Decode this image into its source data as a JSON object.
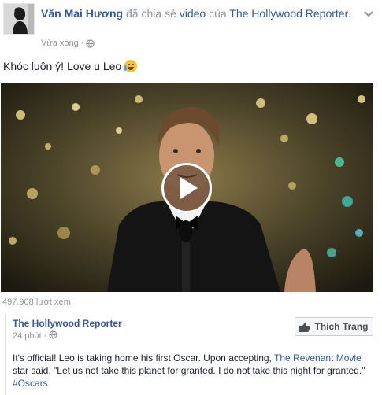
{
  "post": {
    "author": "Văn Mai Hương",
    "action_text": "đã chia sẻ",
    "video_link": "video",
    "of_text": "của",
    "page_name": "The Hollywood Reporter",
    "period": ".",
    "timestamp": "Vừa xong",
    "dot": "·",
    "status_text": "Khóc luôn ý! Love u Leo"
  },
  "video": {
    "view_count": "497.908 lượt xem"
  },
  "attachment": {
    "page_name": "The Hollywood Reporter",
    "timestamp": "24 phút",
    "dot": "·",
    "like_button": "Thích Trang",
    "text_part1": "It's official! Leo is taking home his first Oscar. Upon accepting, ",
    "link_movie": "The Revenant Movie",
    "text_part2": " star said, \"Let us not take this planet for granted. I do not take this night for granted.\" ",
    "hashtag": "#Oscars"
  },
  "icons": {
    "globe": "globe-icon",
    "chevron": "chevron-down-icon",
    "play": "play-icon",
    "thumb": "thumbs-up-icon",
    "emoji": "crying-laughing-emoji"
  },
  "colors": {
    "link": "#365899",
    "meta": "#90949c",
    "text": "#1d2129"
  }
}
